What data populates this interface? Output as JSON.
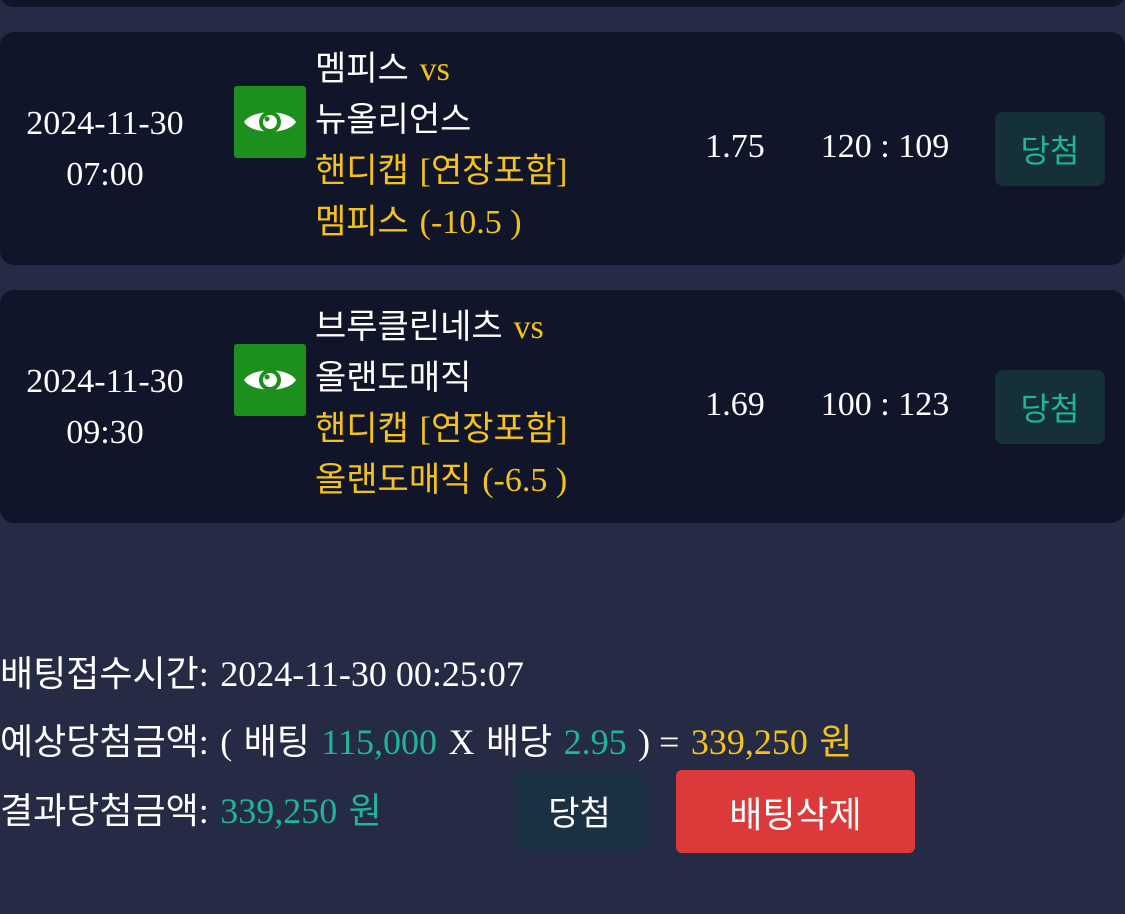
{
  "bets": [
    {
      "date": "2024-11-30",
      "time": "07:00",
      "home": "멤피스",
      "vs": "vs",
      "away": "뉴올리언스",
      "market_name": "핸디캡",
      "market_tag": "[연장포함]",
      "pick_team": "멤피스",
      "pick_line": "(-10.5 )",
      "odds": "1.75",
      "score": "120 : 109",
      "result": "당첨"
    },
    {
      "date": "2024-11-30",
      "time": "09:30",
      "home": "브루클린네츠",
      "vs": "vs",
      "away": "올랜도매직",
      "market_name": "핸디캡",
      "market_tag": "[연장포함]",
      "pick_team": "올랜도매직",
      "pick_line": "(-6.5 )",
      "odds": "1.69",
      "score": "100 : 123",
      "result": "당첨"
    }
  ],
  "summary": {
    "bet_time_label": "배팅접수시간",
    "bet_time_colon": ":",
    "bet_time_value": "2024-11-30 00:25:07",
    "expected_label": "예상당첨금액",
    "expected_colon": ":",
    "open_paren": "(",
    "bet_word": "배팅",
    "bet_amount": "115,000",
    "times": "X",
    "odds_word": "배당",
    "total_odds": "2.95",
    "close_eq": ") =",
    "expected_amount": "339,250",
    "currency": "원",
    "result_label": "결과당첨금액",
    "result_colon": ":",
    "result_amount": "339,250",
    "result_currency": "원"
  },
  "actions": {
    "win_label": "당첨",
    "delete_label": "배팅삭제"
  },
  "icons": {
    "view": "eye-icon"
  },
  "colors": {
    "background": "#252a45",
    "card": "#11152a",
    "accent_yellow": "#f4c21b",
    "accent_teal": "#1fb595",
    "eye_button": "#1c8f1c",
    "delete_button": "#dc3a3a"
  }
}
